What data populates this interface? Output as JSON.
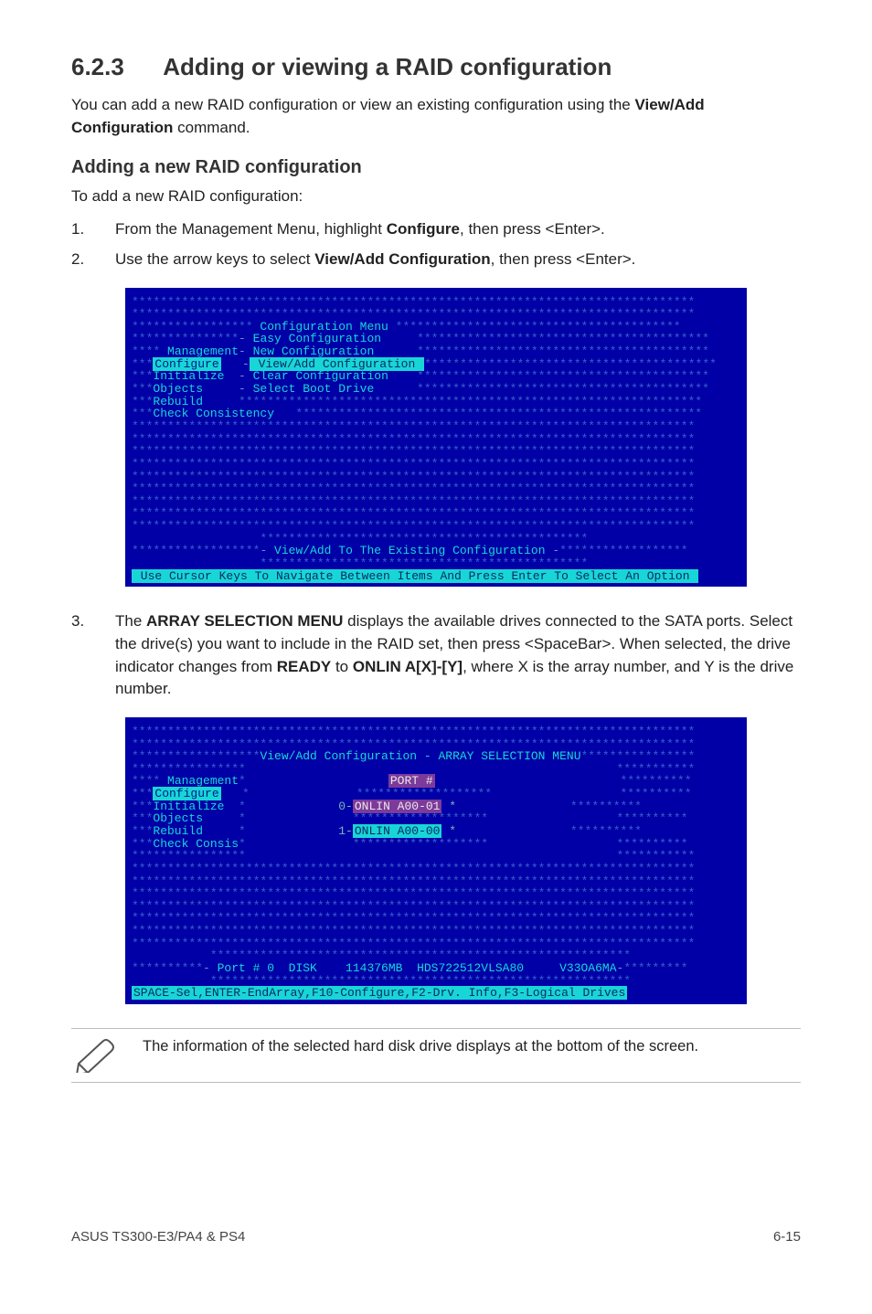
{
  "section": {
    "number": "6.2.3",
    "title": "Adding or viewing a RAID configuration",
    "intro_a": "You can add a new RAID configuration or view an existing configuration using the ",
    "intro_cmd": "View/Add Configuration",
    "intro_b": " command."
  },
  "sub": {
    "heading": "Adding a new RAID configuration",
    "lead": "To add a new RAID configuration:"
  },
  "steps_a": {
    "s1_num": "1.",
    "s1_a": "From the Management Menu, highlight ",
    "s1_b": "Configure",
    "s1_c": ", then press <Enter>.",
    "s2_num": "2.",
    "s2_a": "Use the arrow keys to select ",
    "s2_b": "View/Add Configuration",
    "s2_c": ", then press <Enter>."
  },
  "term1": {
    "fill_top1": "*******************************************************************************",
    "fill_top2": "*******************************************************************************",
    "conf_menu_label": " Configuration Menu ",
    "easy": " Easy Configuration",
    "mgmt_left": " Management",
    "newc": " New Configuration",
    "configure": "Configure",
    "viewadd": " View/Add Configuration ",
    "init": "Initialize",
    "clear": "Clear Configuration",
    "objects": "Objects",
    "selboot": "Select Boot Drive",
    "rebuild": "Rebuild",
    "check": "Check Consistency",
    "mid_fill": "*******************************************************************************",
    "viewadd_bar": " View/Add To The Existing Configuration ",
    "bottom": " Use Cursor Keys To Navigate Between Items And Press Enter To Select An Option "
  },
  "steps_b": {
    "s3_num": "3.",
    "s3_a": "The ",
    "s3_b": "ARRAY SELECTION MENU",
    "s3_c": " displays the available drives connected to the SATA ports. Select the drive(s) you want to include in the RAID set, then press <SpaceBar>. When selected, the drive indicator changes from ",
    "s3_d": "READY",
    "s3_e": " to ",
    "s3_f": "ONLIN A[X]-[Y]",
    "s3_g": ", where X is the array number, and Y is the drive number."
  },
  "term2": {
    "fill_top1": "*******************************************************************************",
    "fill_top2": "*******************************************************************************",
    "title": "View/Add Configuration - ARRAY SELECTION MENU",
    "mgmt": " Management",
    "port_hdr": "PORT #",
    "configure": "Configure",
    "init": "Initialize",
    "line0": "0-",
    "onlin0": "ONLIN A00-01",
    "objects": "Objects",
    "rebuild": "Rebuild",
    "line1": "1-",
    "onlin1": "ONLIN A00-00",
    "check": "Check Consis",
    "port_detail_label": " Port # 0  DISK    114376MB  HDS722512VLSA80     V33OA6MA",
    "bottom": "SPACE-Sel,ENTER-EndArray,F10-Configure,F2-Drv. Info,F3-Logical Drives"
  },
  "note": {
    "text": "The information of the selected hard disk drive displays at the bottom of the screen."
  },
  "footer": {
    "left": "ASUS TS300-E3/PA4 & PS4",
    "right": "6-15"
  }
}
